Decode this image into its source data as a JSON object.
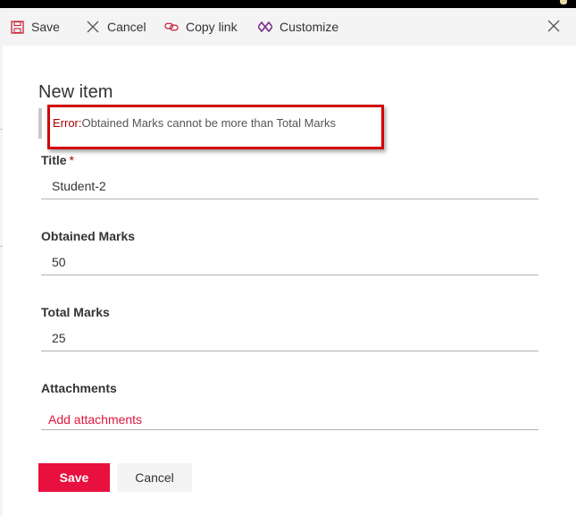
{
  "toolbar": {
    "save_label": "Save",
    "cancel_label": "Cancel",
    "copy_link_label": "Copy link",
    "customize_label": "Customize"
  },
  "panel": {
    "title": "New item"
  },
  "error": {
    "prefix": "Error:",
    "message": "Obtained Marks cannot be more than Total Marks"
  },
  "form": {
    "title": {
      "label": "Title",
      "required_mark": "*",
      "value": "Student-2"
    },
    "obtained_marks": {
      "label": "Obtained Marks",
      "value": "50"
    },
    "total_marks": {
      "label": "Total Marks",
      "value": "25"
    },
    "attachments": {
      "label": "Attachments",
      "link_label": "Add attachments"
    }
  },
  "footer": {
    "save_label": "Save",
    "cancel_label": "Cancel"
  },
  "colors": {
    "accent": "#e8103e",
    "error_red": "#a80000",
    "highlight_red": "#d20000",
    "toolbar_bg": "#f4f4f4",
    "customize_purple": "#7a2e8c"
  },
  "icons": {
    "save": "save-icon",
    "cancel": "cancel-x-icon",
    "copy_link": "link-icon",
    "customize": "customize-icon",
    "close": "close-icon"
  }
}
